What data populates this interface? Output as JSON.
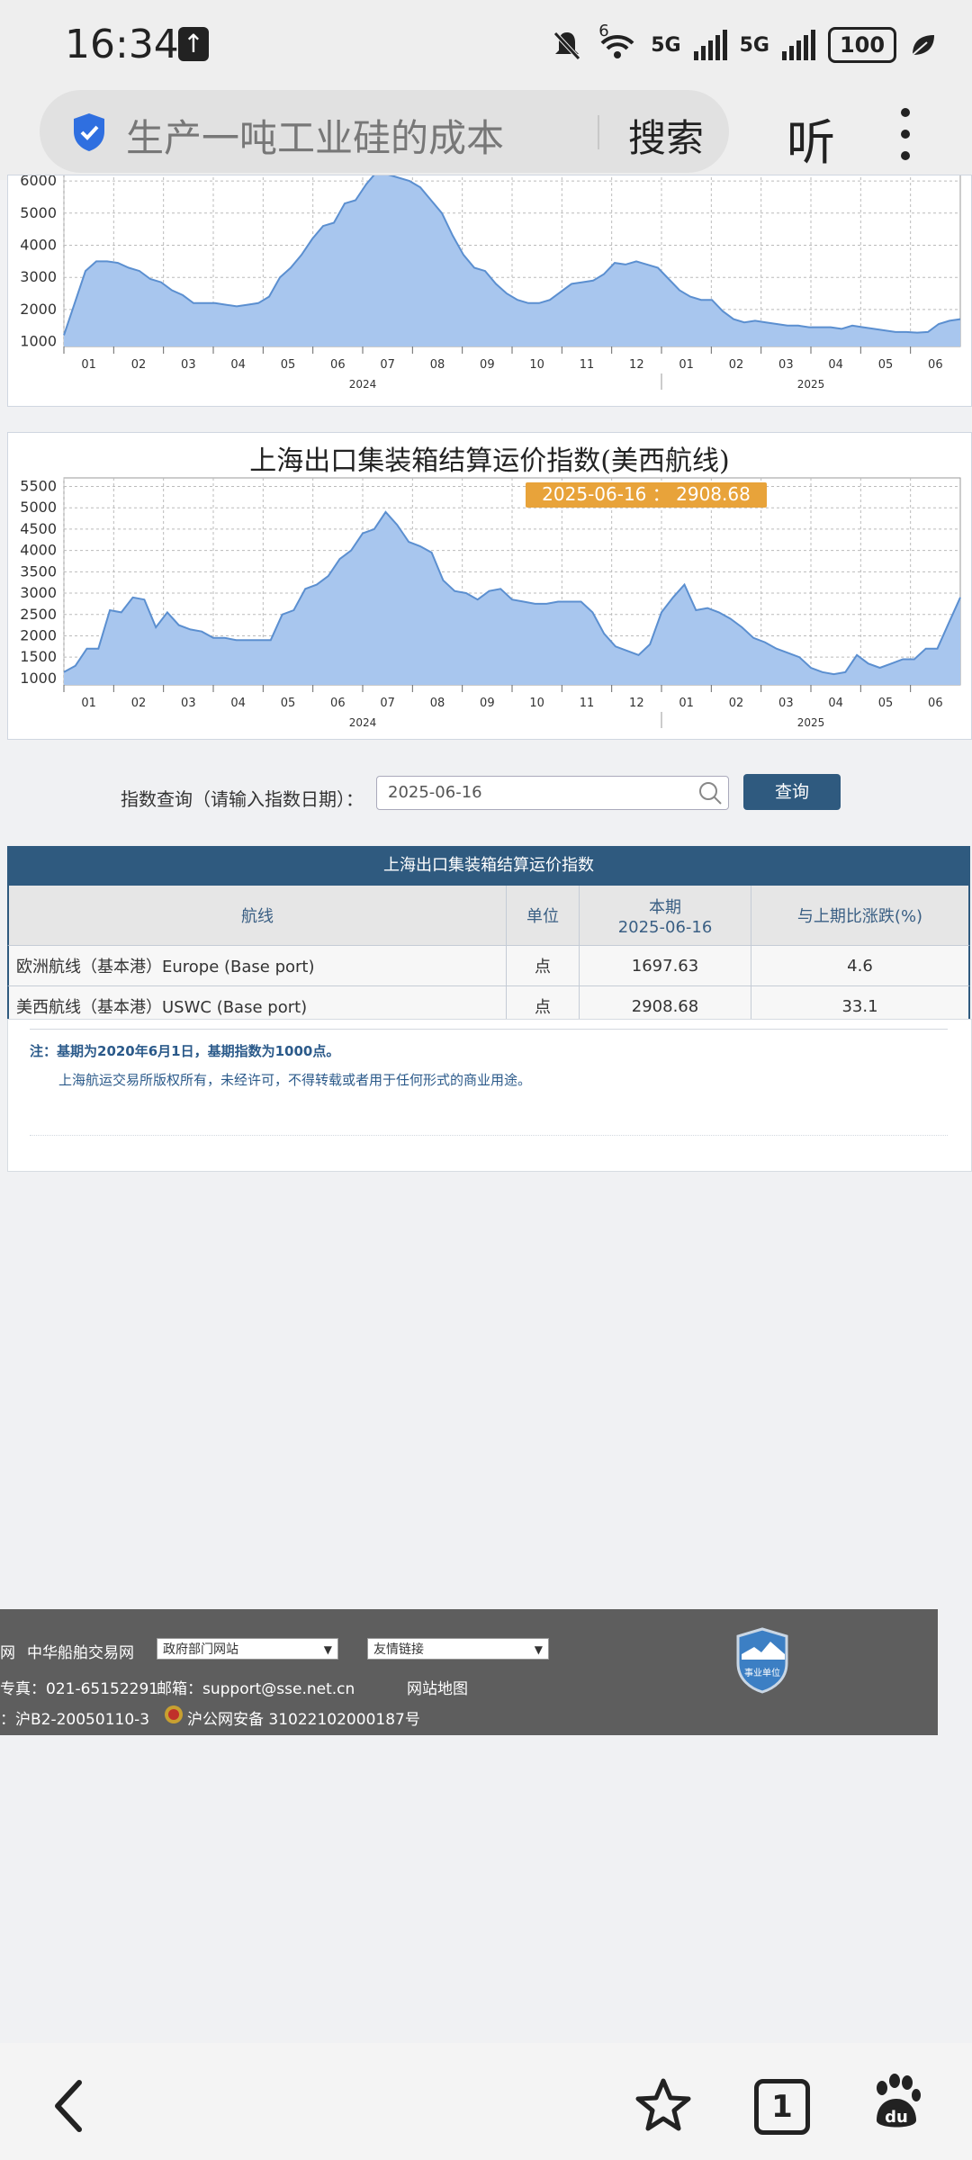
{
  "status_bar": {
    "time": "16:34",
    "signal_label_1": "5G",
    "signal_label_2": "5G",
    "wifi_label": "6",
    "battery": "100"
  },
  "browser": {
    "search_query": "生产一吨工业硅的成本",
    "search_button": "搜索",
    "listen_button": "听"
  },
  "chart_data": [
    {
      "type": "area",
      "title": "",
      "y_ticks": [
        1000,
        2000,
        3000,
        4000,
        5000,
        6000
      ],
      "ylim": [
        850,
        6450
      ],
      "x_month_labels": [
        "01",
        "02",
        "03",
        "04",
        "05",
        "06",
        "07",
        "08",
        "09",
        "10",
        "11",
        "12",
        "01",
        "02",
        "03",
        "04",
        "05",
        "06"
      ],
      "year_labels": [
        "2024",
        "2025"
      ],
      "grid": true,
      "values": [
        1200,
        2200,
        3200,
        3500,
        3500,
        3450,
        3300,
        3200,
        2950,
        2850,
        2600,
        2450,
        2200,
        2200,
        2200,
        2150,
        2100,
        2150,
        2200,
        2400,
        3000,
        3300,
        3700,
        4200,
        4600,
        4700,
        5300,
        5400,
        5900,
        6300,
        6200,
        6100,
        6000,
        5800,
        5400,
        5000,
        4300,
        3700,
        3300,
        3200,
        2800,
        2500,
        2300,
        2200,
        2200,
        2300,
        2550,
        2800,
        2850,
        2900,
        3100,
        3450,
        3400,
        3500,
        3400,
        3300,
        2950,
        2600,
        2400,
        2300,
        2300,
        1950,
        1700,
        1600,
        1650,
        1600,
        1550,
        1500,
        1500,
        1450,
        1450,
        1450,
        1400,
        1500,
        1450,
        1400,
        1350,
        1300,
        1300,
        1280,
        1300,
        1550,
        1650,
        1700
      ]
    },
    {
      "type": "area",
      "title": "上海出口集装箱结算运价指数(美西航线)",
      "tooltip": "2025-06-16 ： 2908.68",
      "y_ticks": [
        1000,
        1500,
        2000,
        2500,
        3000,
        3500,
        4000,
        4500,
        5000,
        5500
      ],
      "ylim": [
        850,
        5700
      ],
      "x_month_labels": [
        "01",
        "02",
        "03",
        "04",
        "05",
        "06",
        "07",
        "08",
        "09",
        "10",
        "11",
        "12",
        "01",
        "02",
        "03",
        "04",
        "05",
        "06"
      ],
      "year_labels": [
        "2024",
        "2025"
      ],
      "grid": true,
      "values": [
        1150,
        1300,
        1700,
        1700,
        2600,
        2550,
        2900,
        2850,
        2200,
        2550,
        2250,
        2150,
        2100,
        1950,
        1950,
        1900,
        1900,
        1900,
        1900,
        2500,
        2600,
        3100,
        3200,
        3400,
        3800,
        4000,
        4400,
        4500,
        4900,
        4600,
        4200,
        4100,
        3950,
        3300,
        3050,
        3000,
        2850,
        3050,
        3100,
        2850,
        2800,
        2750,
        2750,
        2800,
        2800,
        2800,
        2550,
        2050,
        1750,
        1650,
        1550,
        1800,
        2550,
        2900,
        3200,
        2600,
        2650,
        2550,
        2400,
        2200,
        1950,
        1850,
        1700,
        1600,
        1500,
        1250,
        1150,
        1100,
        1150,
        1550,
        1350,
        1250,
        1350,
        1450,
        1450,
        1700,
        1700,
        2300,
        2900
      ]
    }
  ],
  "query": {
    "label": "指数查询（请输入指数日期）：",
    "date_value": "2025-06-16",
    "button": "查询"
  },
  "table": {
    "title": "上海出口集装箱结算运价指数",
    "headers": [
      "航线",
      "单位",
      "本期",
      "2025-06-16",
      "与上期比涨跌(%)"
    ],
    "rows": [
      [
        "欧洲航线（基本港）Europe (Base port)",
        "点",
        "1697.63",
        "4.6"
      ],
      [
        "美西航线（基本港）USWC (Base port)",
        "点",
        "2908.68",
        "33.1"
      ]
    ]
  },
  "notes": {
    "line1": "注：基期为2020年6月1日，基期指数为1000点。",
    "line2": "上海航运交易所版权所有，未经许可，不得转载或者用于任何形式的商业用途。"
  },
  "footer": {
    "link_partial": "网",
    "link_ship": "中华船舶交易网",
    "select_gov": "政府部门网站",
    "select_friends": "友情链接",
    "fax": "专真：021-65152291",
    "email": "邮箱：support@sse.net.cn",
    "sitemap": "网站地图",
    "icp": "：沪B2-20050110-3",
    "police": "沪公网安备 31022102000187号",
    "badge_text": "事业单位"
  }
}
